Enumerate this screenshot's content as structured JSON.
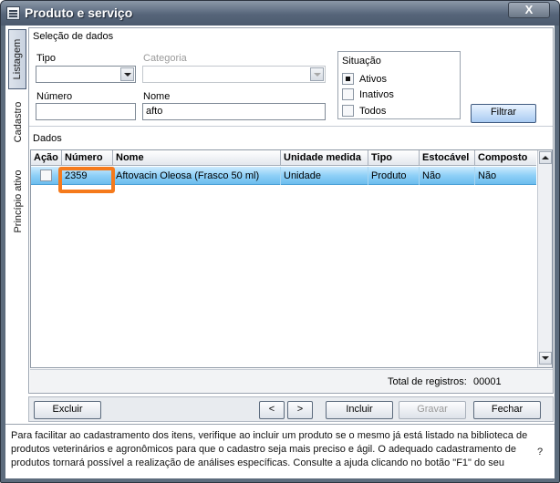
{
  "window": {
    "title": "Produto e serviço",
    "close_label": "X"
  },
  "side_tabs": [
    "Listagem",
    "Cadastro",
    "Princípio ativo"
  ],
  "selection": {
    "caption": "Seleção de dados",
    "tipo_label": "Tipo",
    "categoria_label": "Categoria",
    "numero_label": "Número",
    "nome_label": "Nome",
    "nome_value": "afto",
    "situacao": {
      "caption": "Situação",
      "options": [
        "Ativos",
        "Inativos",
        "Todos"
      ],
      "selected": "Ativos"
    },
    "filter_button": "Filtrar"
  },
  "grid": {
    "caption": "Dados",
    "columns": [
      "Ação",
      "Número",
      "Nome",
      "Unidade medida",
      "Tipo",
      "Estocável",
      "Composto"
    ],
    "rows": [
      {
        "numero": "2359",
        "nome": "Aftovacin Oleosa (Frasco 50 ml)",
        "unidade": "Unidade",
        "tipo": "Produto",
        "estocavel": "Não",
        "composto": "Não"
      }
    ],
    "total_label": "Total de registros:",
    "total_value": "00001"
  },
  "toolbar": {
    "excluir": "Excluir",
    "prev": "<",
    "next": ">",
    "incluir": "Incluir",
    "gravar": "Gravar",
    "fechar": "Fechar"
  },
  "help": {
    "text": "Para facilitar ao cadastramento dos itens, verifique ao incluir um produto se o mesmo já está listado na biblioteca de produtos veterinários e agronômicos para que o cadastro seja mais preciso e ágil. O adequado cadastramento de produtos tornará possível a realização de análises específicas. Consulte a ajuda clicando no botão \"F1\" do seu",
    "question": "?"
  }
}
